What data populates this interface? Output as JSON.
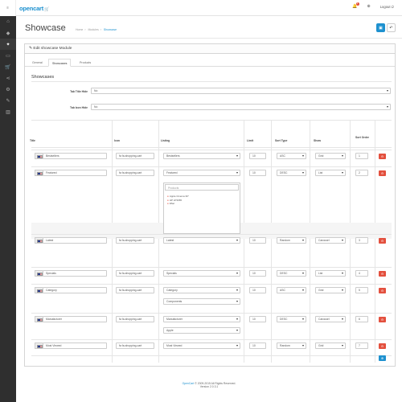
{
  "app": {
    "logo": "opencart",
    "logout": "Logout",
    "notification_count": "1"
  },
  "header": {
    "title": "Showcase",
    "breadcrumb": [
      "Home",
      "Modules",
      "Showcase"
    ]
  },
  "panel": {
    "title": "Edit showcase Module"
  },
  "tabs": [
    "General",
    "Showcases",
    "Products"
  ],
  "section_title": "Showcases",
  "tab_title_hide": {
    "label": "Tab Title Hide",
    "value": "No"
  },
  "tab_icon_hide": {
    "label": "Tab Icon Hide",
    "value": "No"
  },
  "table": {
    "headers": [
      "Title",
      "Icon",
      "Listing",
      "Limit",
      "Sort Type",
      "Show",
      "Sort Order"
    ],
    "rows": [
      {
        "title": "Bestsellers",
        "icon": "fa fa-shopping-cart",
        "listing": "Bestsellers",
        "limit": "10",
        "sort": "ASC",
        "show": "Grid",
        "order": "1"
      },
      {
        "title": "Featured",
        "icon": "fa fa-shopping-cart",
        "listing": "Featured",
        "limit": "10",
        "sort": "DESC",
        "show": "List",
        "order": "2",
        "products_placeholder": "Products",
        "products": [
          "Apple Cinema 30\"",
          "HP LP3065",
          "iMac"
        ]
      },
      {
        "title": "Latest",
        "icon": "fa fa-shopping-cart",
        "listing": "Latest",
        "limit": "10",
        "sort": "Random",
        "show": "Carousel",
        "order": "3"
      },
      {
        "title": "Specials",
        "icon": "fa fa-shopping-cart",
        "listing": "Specials",
        "limit": "10",
        "sort": "DESC",
        "show": "List",
        "order": "4"
      },
      {
        "title": "Category",
        "icon": "fa fa-shopping-cart",
        "listing": "Category",
        "limit": "10",
        "sort": "ASC",
        "show": "Grid",
        "order": "5",
        "sub": "Components"
      },
      {
        "title": "Manufacturer",
        "icon": "fa fa-shopping-cart",
        "listing": "Manufacturer",
        "limit": "10",
        "sort": "DESC",
        "show": "Carousel",
        "order": "6",
        "sub": "Apple"
      },
      {
        "title": "Most Viewed",
        "icon": "fa fa-shopping-cart",
        "listing": "Most Viewed",
        "limit": "10",
        "sort": "Random",
        "show": "Grid",
        "order": "7"
      }
    ]
  },
  "footer": {
    "brand": "OpenCart",
    "copy": " © 2009-2015 All Rights Reserved.",
    "version": "Version 2.0.3.1"
  }
}
